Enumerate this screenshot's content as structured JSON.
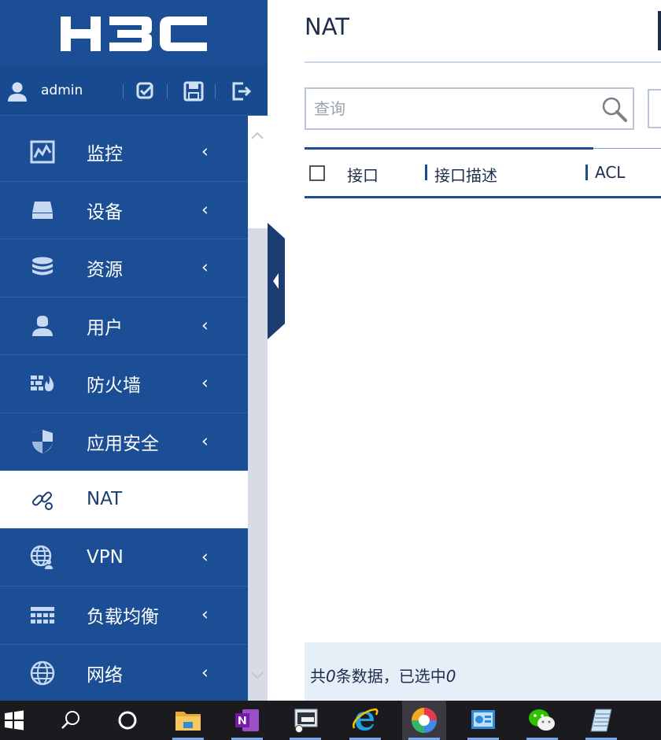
{
  "brand": {
    "logo_text": "H3C"
  },
  "user": {
    "name": "admin"
  },
  "sidebar": {
    "items": [
      {
        "label": "监控",
        "icon": "monitor-chart-icon",
        "has_arrow": true
      },
      {
        "label": "设备",
        "icon": "device-icon",
        "has_arrow": true
      },
      {
        "label": "资源",
        "icon": "database-icon",
        "has_arrow": true
      },
      {
        "label": "用户",
        "icon": "user-icon",
        "has_arrow": true
      },
      {
        "label": "防火墙",
        "icon": "firewall-icon",
        "has_arrow": true
      },
      {
        "label": "应用安全",
        "icon": "shield-icon",
        "has_arrow": true
      },
      {
        "label": "NAT",
        "icon": "nat-link-icon",
        "has_arrow": false,
        "active": true
      },
      {
        "label": "VPN",
        "icon": "vpn-globe-icon",
        "has_arrow": true
      },
      {
        "label": "负载均衡",
        "icon": "load-balance-icon",
        "has_arrow": true
      },
      {
        "label": "网络",
        "icon": "network-globe-icon",
        "has_arrow": true
      }
    ],
    "arrow_glyph": "‹"
  },
  "main": {
    "title": "NAT",
    "search": {
      "placeholder": "查询"
    },
    "table": {
      "columns": [
        "接口",
        "接口描述",
        "ACL"
      ]
    },
    "footer": {
      "prefix": "共",
      "total": "0",
      "middle": "条数据，已选中",
      "selected": "0"
    }
  },
  "taskbar": {
    "items": [
      {
        "name": "start-button",
        "icon": "windows-logo-icon"
      },
      {
        "name": "search-button",
        "icon": "search-icon"
      },
      {
        "name": "task-view-button",
        "icon": "cortana-circle-icon"
      },
      {
        "name": "file-explorer",
        "icon": "folder-icon"
      },
      {
        "name": "onenote",
        "icon": "onenote-icon"
      },
      {
        "name": "remote-desktop",
        "icon": "remote-desktop-icon"
      },
      {
        "name": "internet-explorer",
        "icon": "ie-icon"
      },
      {
        "name": "browser-360",
        "icon": "browser-icon",
        "active": true
      },
      {
        "name": "screen-tool",
        "icon": "dashboard-icon"
      },
      {
        "name": "wechat",
        "icon": "wechat-icon"
      },
      {
        "name": "notepad",
        "icon": "notepad-icon"
      }
    ]
  },
  "colors": {
    "sidebar": "#1c4e96",
    "text_dark": "#1f2d4d",
    "footer_bg": "#e6eef8"
  }
}
